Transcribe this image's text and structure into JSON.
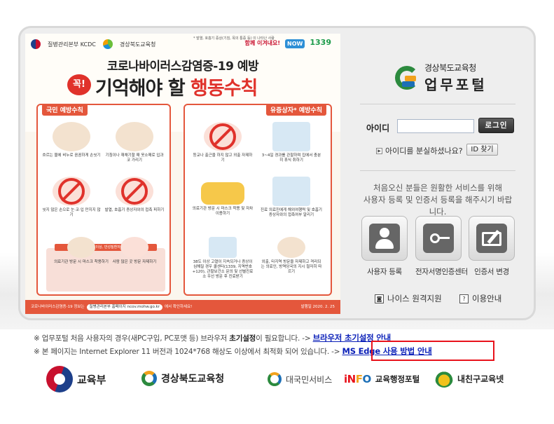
{
  "poster": {
    "logo_kdca": "질병관리본부 KCDC",
    "logo_gov": "경상북도교육청",
    "logo_right_a": "함께 이겨내요!",
    "logo_right_b": "NOW",
    "logo_right_c": "1339",
    "title_line1": "코로나바이러스감염증-19 예방",
    "badge": "꼭!",
    "title_line2_black": "기억해야 할 ",
    "title_line2_red": "행동수칙",
    "left_panel_head": "국민 예방수칙",
    "right_panel_head": "유증상자* 예방수칙",
    "right_note": "* 발열, 호흡기 증상(기침, 목의 통증 등) 이 나타난 사람",
    "left_tiles": [
      "흐르는 물에 비누로 꼼꼼하게 손씻기",
      "기침이나 재채기할 때 옷소매로 입과 코 가리기",
      "씻지 않은 손으로 눈·코·입 만지지 않기",
      "발열, 호흡기 증상자와의 접촉 피하기",
      "의료기관 방문 시 마스크 착용하기",
      "사람 많은 곳 방문 자제하기"
    ],
    "left_banner": "특히 임신부, 65세 이상, 만성질환자 외출 시 꼭 준수",
    "right_tiles": [
      "등교나 출근을 하지 않고 외출 자제하기",
      "3~4일 경과를 관찰하며 집에서 충분히 휴식 취하기",
      "의료기관 방문 시 마스크 착용 및 자차 이용하기",
      "진료 의료진에게 해외여행력 및 호흡기 증상자와의 접촉여부 알리기",
      "38도 이상 고열이 지속되거나 증상이 심해질 경우 콜센터(1339, 지역번호+120), 관할보건소 문의 및 선별진료소 우선 방문 후 진료받기",
      "외출, 타지역 방문을 자제하고 격리되는 의료인, 방역당국의 지시 철저히 따르기"
    ],
    "footer_text": "코로나바이러스감염증-19 정보는",
    "footer_pill": "질병관리본부 홈페이지 ncov.mohw.go.kr",
    "footer_tail": "에서 확인하세요!",
    "footer_date": "발행일 2020. 2. 25"
  },
  "brand": {
    "sub": "경상북도교육청",
    "main": "업무포털"
  },
  "login": {
    "id_label": "아이디",
    "id_value": "",
    "login_button": "로그인",
    "forgot_text": "아이디를 분실하셨나요?",
    "id_find_button": "ID 찾기"
  },
  "first_visit": {
    "line1": "처음오신 분들은 원활한 서비스를 위해",
    "line2": "사용자 등록 및 인증서 등록을 해주시기 바랍니다."
  },
  "services": [
    {
      "label": "사용자 등록",
      "icon": "user-icon"
    },
    {
      "label": "전자서명인증센터",
      "icon": "key-icon"
    },
    {
      "label": "인증서 변경",
      "icon": "certificate-edit-icon"
    }
  ],
  "bottom_links": {
    "neis": "나이스 원격지원",
    "guide": "이용안내"
  },
  "notices": {
    "n1_prefix": "※ 업무포털 처음 사용자의 경우(새PC구입, PC포맷 등) 브라우저 ",
    "n1_bold": "초기설정",
    "n1_mid": "이 필요합니다. -> ",
    "n1_link": "브라우저 초기설정 안내",
    "n2_prefix": "※ 본 페이지는 Internet Explorer 11 버전과 1024*768 해상도 이상에서 최적화 되어 있습니다. -> ",
    "n2_link": "MS Edge 사용 방법 안내"
  },
  "footer_logos": {
    "moe": "교육부",
    "gbe": "경상북도교육청",
    "cs": "대국민서비스",
    "info_brand_a": "i",
    "info_brand_b": "N",
    "info_brand_c": "F",
    "info_brand_d": "O",
    "info_text": "교육행정포털",
    "nae": "내친구교육넷"
  },
  "colors": {
    "accent_red": "#e8121b",
    "link_blue": "#0a1fb8",
    "poster_orange": "#e4573c"
  }
}
